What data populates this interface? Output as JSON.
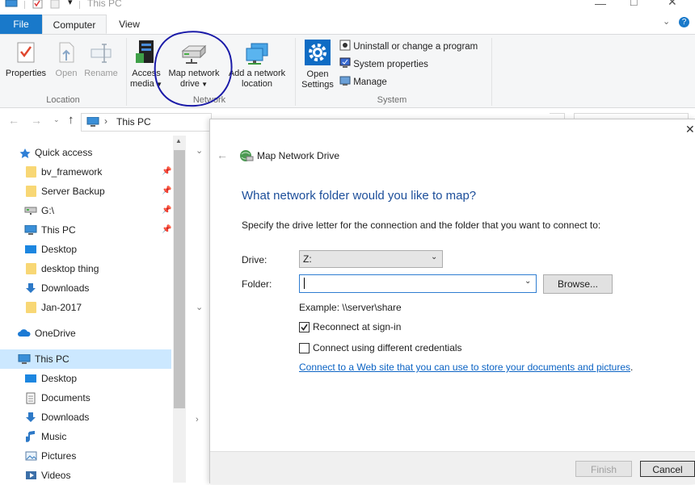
{
  "window": {
    "title": "This PC"
  },
  "ribbon": {
    "tabs": [
      {
        "label": "File"
      },
      {
        "label": "Computer"
      },
      {
        "label": "View"
      }
    ],
    "location": {
      "label": "Location",
      "buttons": [
        {
          "label": "Properties"
        },
        {
          "label": "Open"
        },
        {
          "label": "Rename"
        }
      ]
    },
    "network": {
      "label": "Network",
      "access_media": {
        "line1": "Access",
        "line2": "media"
      },
      "map_drive": {
        "line1": "Map network",
        "line2": "drive"
      },
      "add_location": {
        "line1": "Add a network",
        "line2": "location"
      }
    },
    "system": {
      "label": "System",
      "open_settings": {
        "line1": "Open",
        "line2": "Settings"
      },
      "uninstall": "Uninstall or change a program",
      "properties": "System properties",
      "manage": "Manage"
    }
  },
  "address": {
    "path": "This PC"
  },
  "nav": {
    "quick_access": "Quick access",
    "items": [
      {
        "label": "bv_framework"
      },
      {
        "label": "Server Backup"
      },
      {
        "label": "G:\\"
      },
      {
        "label": "This PC"
      },
      {
        "label": "Desktop"
      },
      {
        "label": "desktop thing"
      },
      {
        "label": "Downloads"
      },
      {
        "label": "Jan-2017"
      }
    ],
    "onedrive": "OneDrive",
    "this_pc": "This PC",
    "pc_items": [
      {
        "label": "Desktop"
      },
      {
        "label": "Documents"
      },
      {
        "label": "Downloads"
      },
      {
        "label": "Music"
      },
      {
        "label": "Pictures"
      },
      {
        "label": "Videos"
      }
    ]
  },
  "dialog": {
    "title": "Map Network Drive",
    "heading": "What network folder would you like to map?",
    "instruction": "Specify the drive letter for the connection and the folder that you want to connect to:",
    "drive_label": "Drive:",
    "drive_value": "Z:",
    "folder_label": "Folder:",
    "folder_value": "",
    "browse": "Browse...",
    "example": "Example: \\\\server\\share",
    "reconnect": "Reconnect at sign-in",
    "reconnect_checked": true,
    "diff_creds": "Connect using different credentials",
    "diff_creds_checked": false,
    "link": "Connect to a Web site that you can use to store your documents and pictures",
    "link_suffix": ".",
    "finish": "Finish",
    "cancel": "Cancel"
  },
  "colors": {
    "accent": "#1979ca",
    "heading": "#1c4e9a",
    "link": "#0b63c4",
    "annotation": "#1a1aa8"
  }
}
